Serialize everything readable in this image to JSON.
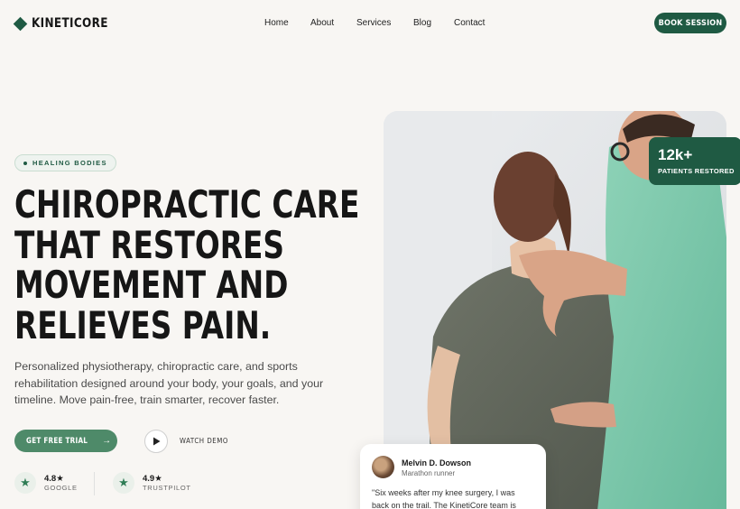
{
  "brand": {
    "name": "KINETICORE"
  },
  "nav": {
    "items": [
      "Home",
      "About",
      "Services",
      "Blog",
      "Contact"
    ],
    "cta": "BOOK SESSION"
  },
  "hero": {
    "badge": "HEALING BODIES",
    "headline": [
      "CHIROPRACTIC CARE",
      "THAT RESTORES",
      "MOVEMENT AND",
      "RELIEVES PAIN."
    ],
    "description": "Personalized physiotherapy, chiropractic care, and sports rehabilitation designed around your body, your goals, and your timeline. Move pain-free, train smarter, recover faster.",
    "primary_cta": "GET FREE TRIAL",
    "secondary_cta": "WATCH DEMO"
  },
  "ratings": [
    {
      "score": "4.8★",
      "source": "GOOGLE"
    },
    {
      "score": "4.9★",
      "source": "TRUSTPILOT"
    }
  ],
  "stat": {
    "value": "12k+",
    "label": "PATIENTS RESTORED"
  },
  "review": {
    "name": "Melvin D. Dowson",
    "role": "Marathon runner",
    "text": "\"Six weeks after my knee surgery, I was back on the trail. The KinetiCore team is"
  },
  "colors": {
    "brand_green": "#1f5a43",
    "button_green": "#4e8a69",
    "background": "#f8f6f3"
  },
  "icons": {
    "logo": "diamond-logo-icon",
    "arrow": "arrow-right-icon",
    "play": "play-icon",
    "star": "star-icon"
  }
}
